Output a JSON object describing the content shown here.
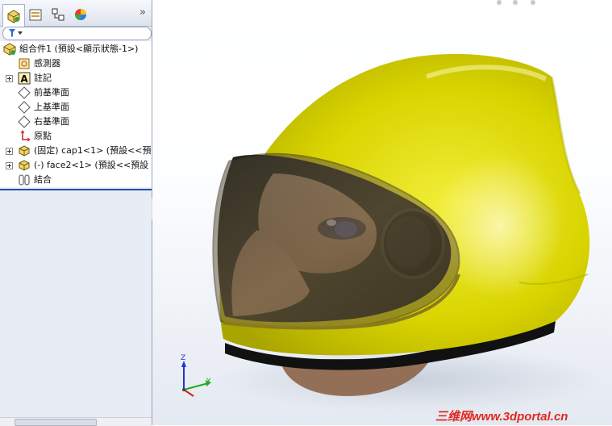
{
  "feature_manager": {
    "tabs": [
      {
        "name": "feature-manager-tab",
        "active": true
      },
      {
        "name": "property-manager-tab",
        "active": false
      },
      {
        "name": "configuration-manager-tab",
        "active": false
      },
      {
        "name": "display-manager-tab",
        "active": false
      }
    ],
    "more_label": "»",
    "filter_label": "▼",
    "tree": [
      {
        "label": "組合件1 (預設<顯示狀態-1>)",
        "icon": "assembly-icon",
        "expander": false,
        "indent": 0
      },
      {
        "label": "感測器",
        "icon": "sensor-icon",
        "expander": false,
        "indent": 1
      },
      {
        "label": "註記",
        "icon": "annotation-icon",
        "expander": true,
        "indent": 1
      },
      {
        "label": "前基準面",
        "icon": "plane-icon",
        "expander": false,
        "indent": 1
      },
      {
        "label": "上基準面",
        "icon": "plane-icon",
        "expander": false,
        "indent": 1
      },
      {
        "label": "右基準面",
        "icon": "plane-icon",
        "expander": false,
        "indent": 1
      },
      {
        "label": "原點",
        "icon": "origin-icon",
        "expander": false,
        "indent": 1
      },
      {
        "label": "(固定) cap1<1> (預設<<預",
        "icon": "part-icon",
        "expander": true,
        "indent": 1
      },
      {
        "label": "(-) face2<1> (預設<<預設",
        "icon": "part-icon",
        "expander": true,
        "indent": 1
      },
      {
        "label": "結合",
        "icon": "mates-icon",
        "expander": false,
        "indent": 1
      }
    ]
  },
  "triad": {
    "x": "",
    "y": "Y",
    "z": "Z"
  },
  "watermark": "三维网www.3dportal.cn",
  "colors": {
    "helmet": "#d6d200",
    "visor": "#6b5a36",
    "accent": "#1f4ea8"
  }
}
